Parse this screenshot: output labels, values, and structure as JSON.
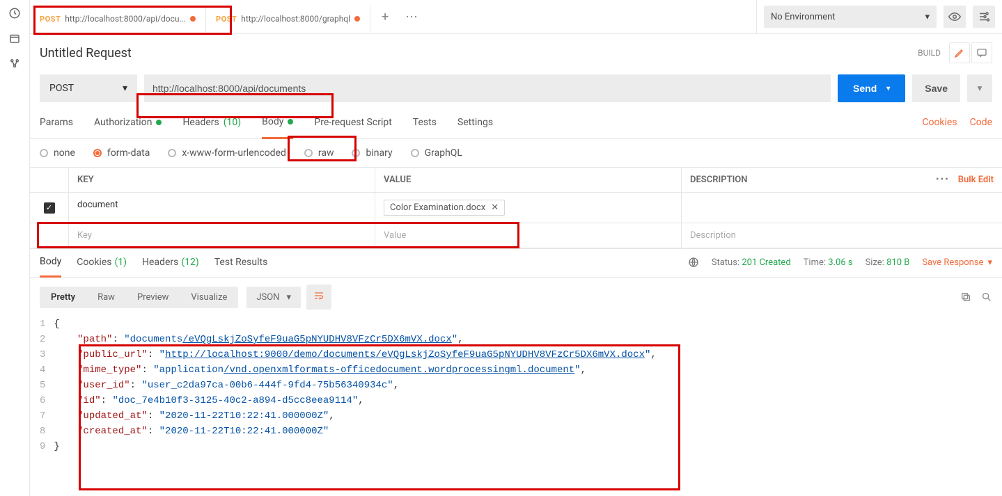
{
  "env": {
    "label": "No Environment"
  },
  "tabs": [
    {
      "method": "POST",
      "url": "http://localhost:8000/api/docu...",
      "dirty": true
    },
    {
      "method": "POST",
      "url": "http://localhost:8000/graphql",
      "dirty": true
    }
  ],
  "request": {
    "title": "Untitled Request",
    "build": "BUILD",
    "method": "POST",
    "url": "http://localhost:8000/api/documents",
    "send": "Send",
    "save": "Save"
  },
  "subtabs": {
    "params": "Params",
    "auth": "Authorization",
    "headers": "Headers",
    "headers_count": "(10)",
    "body": "Body",
    "prereq": "Pre-request Script",
    "tests": "Tests",
    "settings": "Settings",
    "cookies": "Cookies",
    "code": "Code"
  },
  "body_types": {
    "none": "none",
    "form": "form-data",
    "xwww": "x-www-form-urlencoded",
    "raw": "raw",
    "binary": "binary",
    "graphql": "GraphQL"
  },
  "kv": {
    "key_h": "KEY",
    "value_h": "VALUE",
    "desc_h": "DESCRIPTION",
    "bulk": "Bulk Edit",
    "row_key": "document",
    "row_file": "Color Examination.docx",
    "ph_key": "Key",
    "ph_value": "Value",
    "ph_desc": "Description"
  },
  "resp": {
    "tabs": {
      "body": "Body",
      "cookies": "Cookies",
      "cookies_count": "(1)",
      "headers": "Headers",
      "headers_count": "(12)",
      "tests": "Test Results"
    },
    "status_l": "Status:",
    "status_v": "201 Created",
    "time_l": "Time:",
    "time_v": "3.06 s",
    "size_l": "Size:",
    "size_v": "810 B",
    "save": "Save Response"
  },
  "view": {
    "pretty": "Pretty",
    "raw": "Raw",
    "preview": "Preview",
    "visualize": "Visualize",
    "json": "JSON"
  },
  "json_lines": [
    [
      {
        "t": "p",
        "v": "{"
      }
    ],
    [
      {
        "t": "p",
        "v": "    "
      },
      {
        "t": "k",
        "v": "\"path\""
      },
      {
        "t": "p",
        "v": ": "
      },
      {
        "t": "s",
        "v": "\"documents"
      },
      {
        "t": "u",
        "v": "/eVQgLskjZoSyfeF9uaG5pNYUDHV8VFzCr5DX6mVX.docx"
      },
      {
        "t": "s",
        "v": "\""
      },
      {
        "t": "p",
        "v": ","
      }
    ],
    [
      {
        "t": "p",
        "v": "    "
      },
      {
        "t": "k",
        "v": "\"public_url\""
      },
      {
        "t": "p",
        "v": ": "
      },
      {
        "t": "s",
        "v": "\""
      },
      {
        "t": "u",
        "v": "http://localhost:9000/demo/documents/eVQgLskjZoSyfeF9uaG5pNYUDHV8VFzCr5DX6mVX.docx"
      },
      {
        "t": "s",
        "v": "\""
      },
      {
        "t": "p",
        "v": ","
      }
    ],
    [
      {
        "t": "p",
        "v": "    "
      },
      {
        "t": "k",
        "v": "\"mime_type\""
      },
      {
        "t": "p",
        "v": ": "
      },
      {
        "t": "s",
        "v": "\"application"
      },
      {
        "t": "u",
        "v": "/vnd.openxmlformats-officedocument.wordprocessingml.document"
      },
      {
        "t": "s",
        "v": "\""
      },
      {
        "t": "p",
        "v": ","
      }
    ],
    [
      {
        "t": "p",
        "v": "    "
      },
      {
        "t": "k",
        "v": "\"user_id\""
      },
      {
        "t": "p",
        "v": ": "
      },
      {
        "t": "s",
        "v": "\"user_c2da97ca-00b6-444f-9fd4-75b56340934c\""
      },
      {
        "t": "p",
        "v": ","
      }
    ],
    [
      {
        "t": "p",
        "v": "    "
      },
      {
        "t": "k",
        "v": "\"id\""
      },
      {
        "t": "p",
        "v": ": "
      },
      {
        "t": "s",
        "v": "\"doc_7e4b10f3-3125-40c2-a894-d5cc8eea9114\""
      },
      {
        "t": "p",
        "v": ","
      }
    ],
    [
      {
        "t": "p",
        "v": "    "
      },
      {
        "t": "k",
        "v": "\"updated_at\""
      },
      {
        "t": "p",
        "v": ": "
      },
      {
        "t": "s",
        "v": "\"2020-11-22T10:22:41.000000Z\""
      },
      {
        "t": "p",
        "v": ","
      }
    ],
    [
      {
        "t": "p",
        "v": "    "
      },
      {
        "t": "k",
        "v": "\"created_at\""
      },
      {
        "t": "p",
        "v": ": "
      },
      {
        "t": "s",
        "v": "\"2020-11-22T10:22:41.000000Z\""
      }
    ],
    [
      {
        "t": "p",
        "v": "}"
      }
    ]
  ]
}
